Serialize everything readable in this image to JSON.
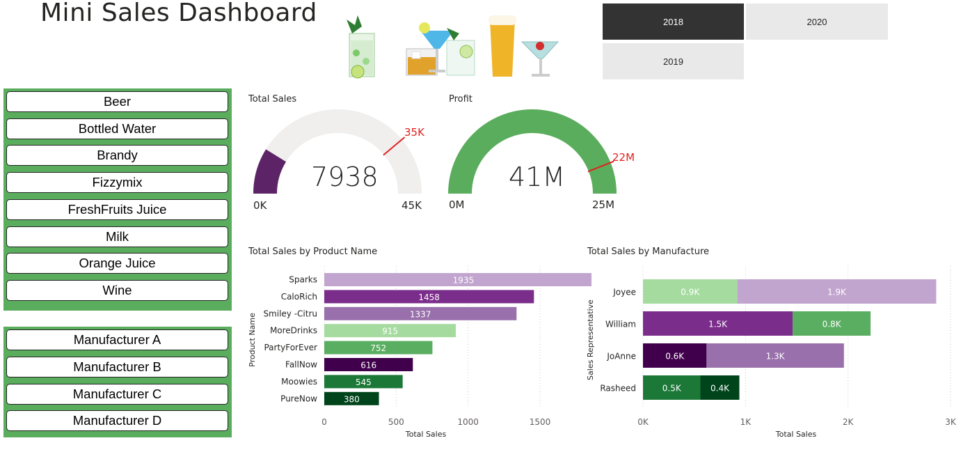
{
  "header": {
    "title": "Mini Sales Dashboard"
  },
  "year_slicer": {
    "items": [
      {
        "label": "2018",
        "selected": true
      },
      {
        "label": "2020",
        "selected": false
      },
      {
        "label": "2019",
        "selected": false
      }
    ]
  },
  "product_slicer": {
    "items": [
      "Beer",
      "Bottled Water",
      "Brandy",
      "Fizzymix",
      "FreshFruits Juice",
      "Milk",
      "Orange Juice",
      "Wine"
    ]
  },
  "manufacturer_slicer": {
    "items": [
      "Manufacturer A",
      "Manufacturer B",
      "Manufacturer C",
      "Manufacturer D"
    ]
  },
  "gauges": {
    "total_sales": {
      "title": "Total Sales",
      "value": 7938,
      "value_label": "7938",
      "min_label": "0K",
      "max_label": "45K",
      "target_label": "35K",
      "min": 0,
      "max": 45000,
      "target": 35000,
      "fill_color": "#5c2466",
      "track_color": "#f0efee"
    },
    "profit": {
      "title": "Profit",
      "value_label": "41M",
      "min_label": "0M",
      "max_label": "25M",
      "target_label": "22M",
      "min": 0,
      "max": 25,
      "target": 22,
      "value": 41,
      "fill_color": "#5bad5e",
      "track_color": "#f0efee"
    }
  },
  "colors": {
    "target_line": "#e02020"
  },
  "chart_data": [
    {
      "type": "bar",
      "orientation": "horizontal",
      "title": "Total Sales by Product Name",
      "xlabel": "Total Sales",
      "ylabel": "Product Name",
      "categories": [
        "Sparks",
        "CaloRich",
        "Smiley -Citru",
        "MoreDrinks",
        "PartyForEver",
        "FallNow",
        "Moowies",
        "PureNow"
      ],
      "values": [
        1935,
        1458,
        1337,
        915,
        752,
        616,
        545,
        380
      ],
      "colors": [
        "#c2a5cf",
        "#7b2d8b",
        "#9970ab",
        "#a6dba0",
        "#5aae61",
        "#40004b",
        "#1b7837",
        "#00441b"
      ],
      "xlim": [
        0,
        1800
      ],
      "xticks": [
        "0",
        "500",
        "1000",
        "1500"
      ],
      "xtick_values": [
        0,
        500,
        1000,
        1500
      ]
    },
    {
      "type": "bar",
      "orientation": "horizontal",
      "stacked": true,
      "title": "Total Sales by Manufacture",
      "xlabel": "Total Sales",
      "ylabel": "Sales Representative",
      "categories": [
        "Joyee",
        "William",
        "JoAnne",
        "Rasheed"
      ],
      "segments": [
        [
          {
            "value": 920,
            "label": "0.9K",
            "color": "#a6dba0"
          },
          {
            "value": 1940,
            "label": "1.9K",
            "color": "#c2a5cf"
          }
        ],
        [
          {
            "value": 1460,
            "label": "1.5K",
            "color": "#7b2d8b"
          },
          {
            "value": 760,
            "label": "0.8K",
            "color": "#5aae61"
          }
        ],
        [
          {
            "value": 620,
            "label": "0.6K",
            "color": "#40004b"
          },
          {
            "value": 1340,
            "label": "1.3K",
            "color": "#9970ab"
          }
        ],
        [
          {
            "value": 560,
            "label": "0.5K",
            "color": "#1b7837"
          },
          {
            "value": 380,
            "label": "0.4K",
            "color": "#00441b"
          }
        ]
      ],
      "xlim": [
        0,
        3000
      ],
      "xticks": [
        "0K",
        "1K",
        "2K",
        "3K"
      ],
      "xtick_values": [
        0,
        1000,
        2000,
        3000
      ]
    }
  ]
}
